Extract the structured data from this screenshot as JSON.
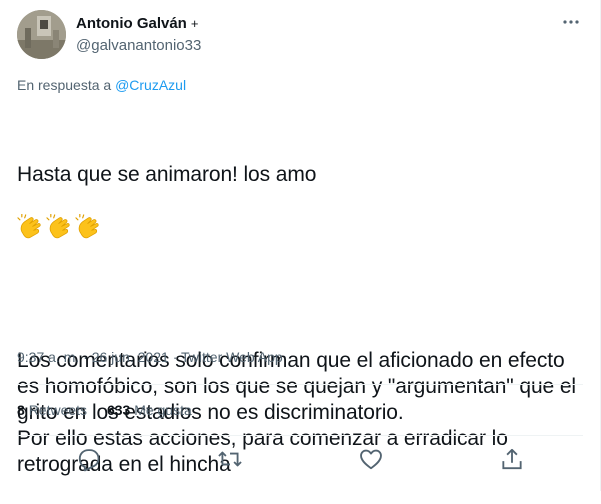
{
  "author": {
    "display_name": "Antonio Galván",
    "badge": "+",
    "handle": "@galvanantonio33"
  },
  "reply": {
    "prefix": "En respuesta a",
    "mention": "@CruzAzul"
  },
  "tweet": {
    "line1": "Hasta que se animaron! los amo",
    "emoji": [
      "clapping-hands",
      "clapping-hands",
      "clapping-hands"
    ],
    "paragraph2": "Los comentarios solo confirman que el aficionado en efecto es homofóbico, son los que se quejan y \"argumentan\" que el grito en los estadios no es discriminatorio.\nPor ello estas acciones, para comenzar a erradicar lo retrograda en el hincha"
  },
  "meta": {
    "time": "9:37 a. m.",
    "separator": "·",
    "date": "26 jun. 2021",
    "app": "Twitter Web App"
  },
  "stats": {
    "retweets_count": "8",
    "retweets_label": "Retweets",
    "likes_count": "633",
    "likes_label": "Me gusta"
  },
  "actions": [
    "reply-icon",
    "retweet-icon",
    "like-icon",
    "share-icon"
  ],
  "colors": {
    "text": "#0f1419",
    "secondary": "#536471",
    "link": "#1d9bf0",
    "divider": "#eff3f4",
    "emoji": "#fcc21b"
  }
}
